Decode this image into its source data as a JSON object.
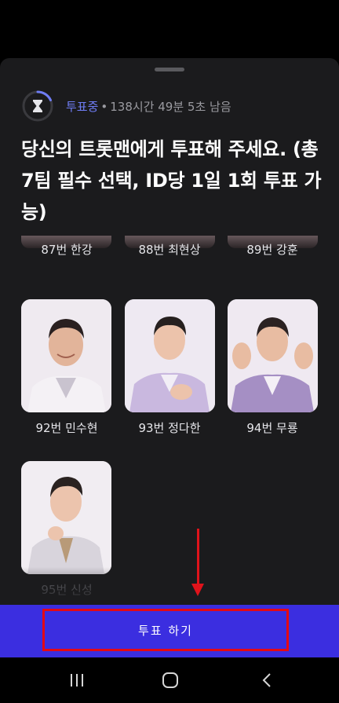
{
  "vote_status": {
    "label": "투표중",
    "separator": "•",
    "remaining": "138시간 49분 5초 남음"
  },
  "title": "당신의 트롯맨에게 투표해 주세요. (총 7팀 필수 선택, ID당 1일 1회 투표 가능)",
  "candidates_top_row": [
    {
      "name": "87번 한강"
    },
    {
      "name": "88번 최현상"
    },
    {
      "name": "89번 강훈"
    }
  ],
  "candidates": [
    {
      "name": "92번 민수현",
      "photo": "portrait-white-suit"
    },
    {
      "name": "93번 정다한",
      "photo": "portrait-lavender-suit"
    },
    {
      "name": "94번 무룡",
      "photo": "portrait-purple-suit"
    },
    {
      "name": "95번 신성",
      "photo": "portrait-grey-suit"
    }
  ],
  "vote_button": {
    "label": "투표 하기"
  },
  "icons": {
    "timer": "hourglass-icon",
    "nav_recent": "recent-apps-icon",
    "nav_home": "home-icon",
    "nav_back": "back-icon"
  },
  "colors": {
    "accent": "#3b2ee0",
    "status_label": "#6f7df5",
    "highlight": "#e50914",
    "sheet_bg": "#1b1b1d"
  }
}
